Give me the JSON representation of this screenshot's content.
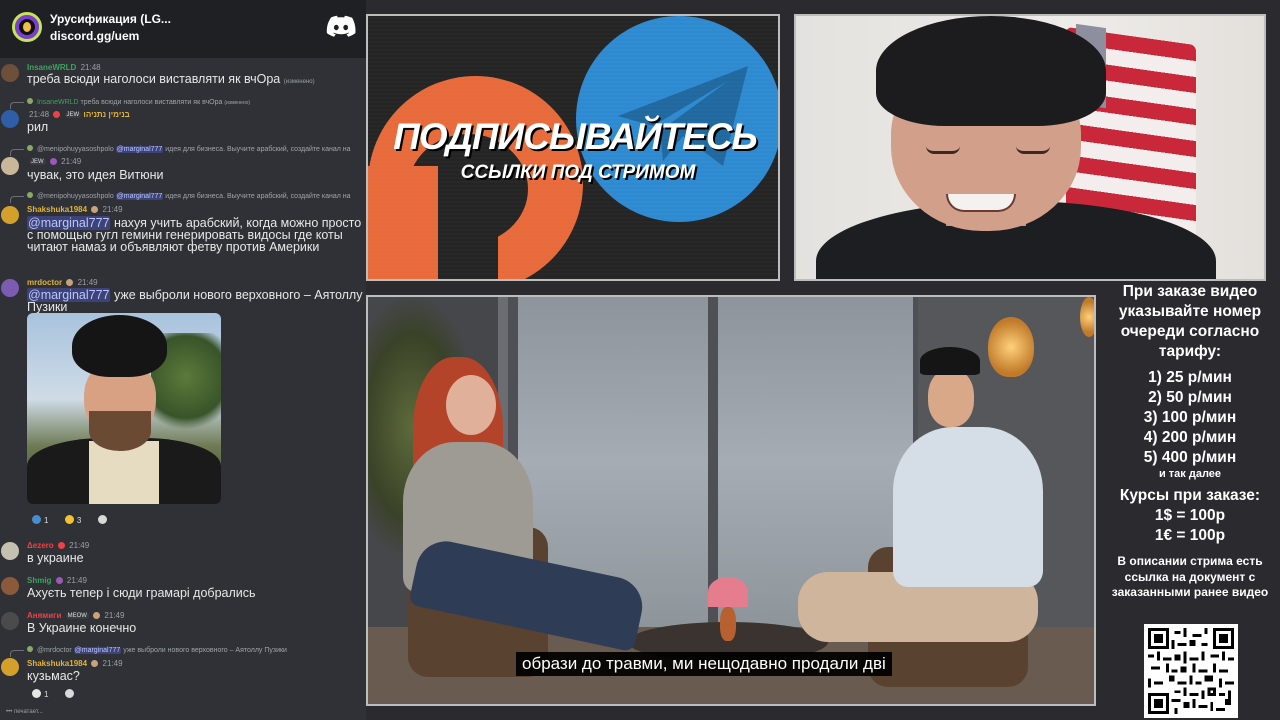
{
  "chat": {
    "server_name": "Урусификация (LG...",
    "server_link": "discord.gg/uem",
    "messages": [
      {
        "user": "InsaneWRLD",
        "time": "21:48",
        "text": "треба всюди наголоси виставляти як вчОра",
        "edited": "(изменено)"
      },
      {
        "reply": "треба всюди наголоси виставляти як вчОра",
        "reply_edited": "(изменено)",
        "user": "בנימין נתניהו",
        "badge": "JEW",
        "time": "21:48",
        "text": "рил"
      },
      {
        "reply_user": "@menipohuyyasoshpolo",
        "reply_mention": "@marginal777",
        "reply": " идея для бизнеса. Выучите арабский, создайте канал на",
        "badge": "JEW",
        "time": "21:49",
        "text": "чувак, это идея Витюни"
      },
      {
        "reply_user": "@menipohuyyasoshpolo",
        "reply_mention": "@marginal777",
        "reply": " идея для бизнеса. Выучите арабский, создайте канал на",
        "user": "Shakshuka1984",
        "time": "21:49",
        "mention": "@marginal777",
        "text": " нахуя учить арабский, когда можно просто с помощью гугл гемини генерировать видосы где коты читают намаз и объявляют фетву против Америки"
      },
      {
        "user": "mrdoctor",
        "time": "21:49",
        "mention": "@marginal777",
        "text": " уже выброли нового верховного – Аятоллу Пузики"
      },
      {
        "user": "Δezero",
        "time": "21:49",
        "text": "в украине"
      },
      {
        "user": "Shmig",
        "time": "21:49",
        "text": "Ахуєть тепер і сюди грамарі добрались"
      },
      {
        "user": "Анямиги",
        "badge": "MEOW",
        "time": "21:49",
        "text": "В Украине конечно"
      },
      {
        "reply_user": "@mrdoctor",
        "reply_mention": "@marginal777",
        "reply": " уже выброли нового верховного – Аятоллу Пузики",
        "user": "Shakshuka1984",
        "time": "21:49",
        "text": "кузьмас?"
      }
    ],
    "reactions_1": [
      {
        "count": "1"
      },
      {
        "count": "3"
      },
      {
        "count": ""
      }
    ],
    "reactions_2": [
      {
        "count": "1"
      },
      {
        "count": ""
      }
    ],
    "typing": "печатает..."
  },
  "promo": {
    "title": "ПОДПИСЫВАЙТЕСЬ",
    "subtitle": "ССЫЛКИ ПОД СТРИМОМ"
  },
  "video": {
    "subtitle": "образи до травми, ми нещодавно продали дві"
  },
  "info": {
    "intro": "При заказе видео указывайте номер очереди согласно тарифу:",
    "tariffs": [
      "1) 25 р/мин",
      "2) 50 р/мин",
      "3) 100 р/мин",
      "4) 200 р/мин",
      "5) 400 р/мин"
    ],
    "etc": "и так далее",
    "courses_title": "Курсы при заказе:",
    "course_usd": "1$ = 100р",
    "course_eur": "1€ = 100р",
    "note": "В описании стрима есть ссылка на документ с заказанными ранее видео"
  },
  "colors": {
    "chat_bg": "#2f3136",
    "mention": "#b9c6ff",
    "boosty": "#e86a3a",
    "telegram": "#2e8ad0"
  }
}
